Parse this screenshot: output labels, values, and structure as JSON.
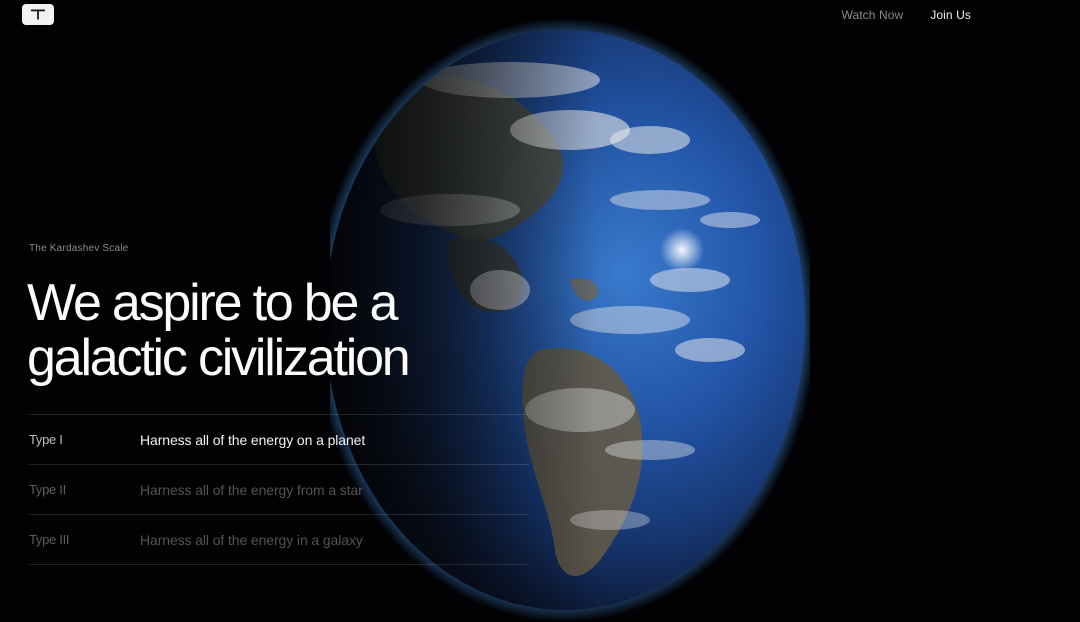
{
  "brand": {
    "logo_icon": "t-logo-icon"
  },
  "nav": {
    "items": [
      {
        "label": "Watch Now"
      },
      {
        "label": "Join Us"
      }
    ]
  },
  "hero": {
    "eyebrow": "The Kardashev Scale",
    "headline": "We aspire to be a galactic civilization",
    "image": "earth-globe"
  },
  "scale": {
    "active_index": 0,
    "items": [
      {
        "type": "Type I",
        "description": "Harness all of the energy on a planet"
      },
      {
        "type": "Type II",
        "description": "Harness all of the energy from a star"
      },
      {
        "type": "Type III",
        "description": "Harness all of the energy in a galaxy"
      }
    ]
  },
  "colors": {
    "background": "#020204",
    "text_primary": "#fbfbfb",
    "text_muted": "#8b8b8b",
    "ocean": "#2a6fd0",
    "atmosphere": "#6fb3ff"
  }
}
